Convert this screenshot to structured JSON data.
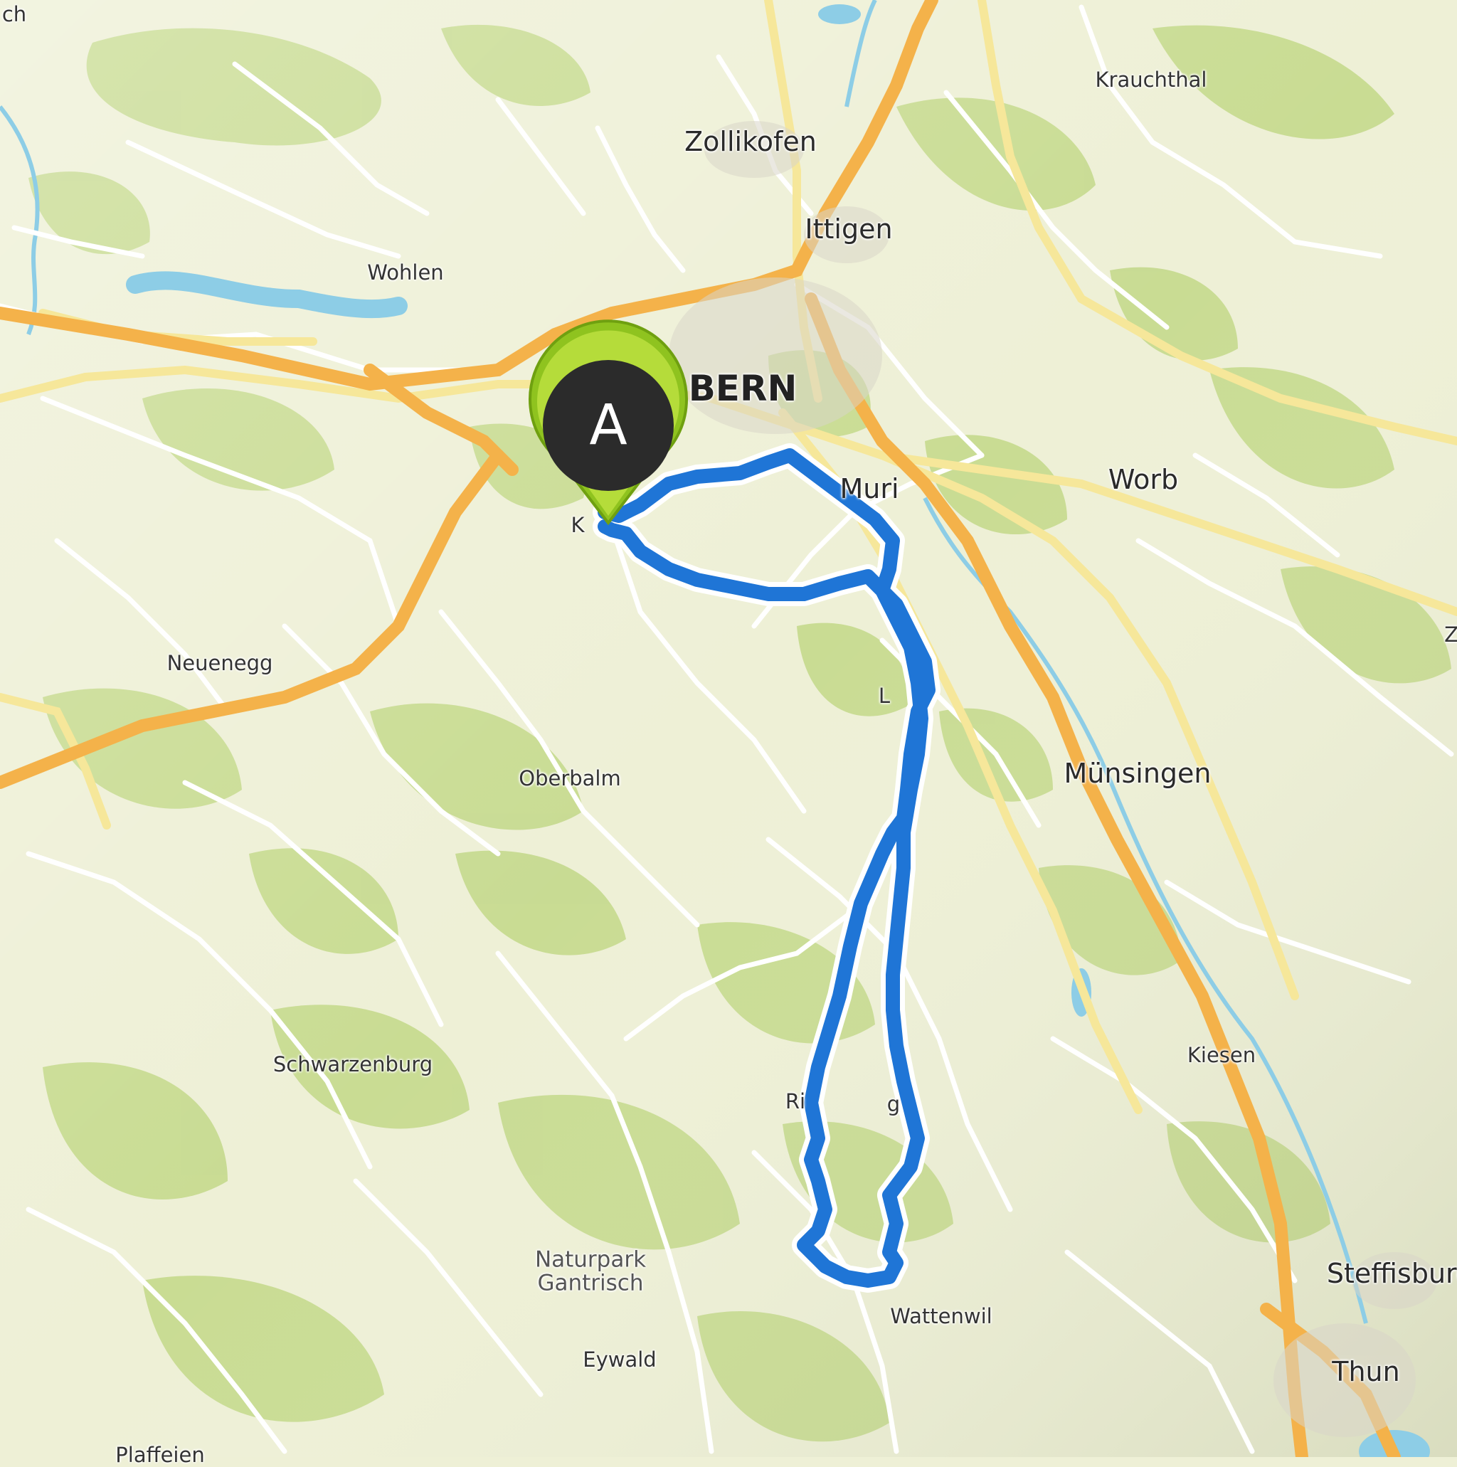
{
  "map": {
    "labels": {
      "bern": "BERN",
      "zollikofen": "Zollikofen",
      "ittigen": "Ittigen",
      "krauchthal": "Krauchthal",
      "wohlen": "Wohlen",
      "muri": "Muri",
      "worb": "Worb",
      "neuenegg": "Neuenegg",
      "oberbalm": "Oberbalm",
      "muensingen": "Münsingen",
      "schwarzenburg": "Schwarzenburg",
      "kiesen": "Kiesen",
      "naturpark": "Naturpark\nGantrisch",
      "wattenwil": "Wattenwil",
      "eywald": "Eywald",
      "steffisburg": "Steffisburg",
      "thun": "Thun",
      "plaffeien": "Plaffeien",
      "edge_ch": "ch",
      "edge_z": "Z",
      "k_partial": "K",
      "ri_partial": "Ri",
      "g_partial": "g",
      "l_partial": "L"
    },
    "route": {
      "color": "#1f75d6",
      "outline_color": "#ffffff"
    },
    "start_marker": {
      "letter": "A",
      "ring_color": "#8fc31f",
      "fill_color": "#2b2b2b"
    },
    "colors": {
      "background": "#eef0d6",
      "forest": "#c4d98c",
      "water": "#8dcde6",
      "highway": "#f4b24a",
      "main_road": "#f6e79a",
      "minor_road": "#ffffff"
    }
  }
}
